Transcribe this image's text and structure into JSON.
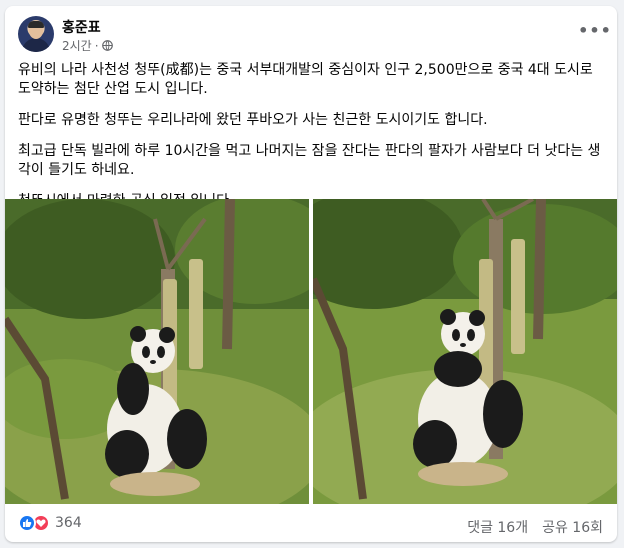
{
  "post": {
    "author": "홍준표",
    "time": "2시간",
    "separator": "·",
    "paragraphs": [
      "유비의 나라 사천성 청뚜(成都)는 중국 서부대개발의 중심이자 인구 2,500만으로 중국 4대 도시로 도약하는 첨단 산업 도시 입니다.",
      "판다로 유명한 청뚜는 우리나라에 왔던 푸바오가 사는 친근한 도시이기도 합니다.",
      "최고급 단독 빌라에 하루 10시간을 먹고 나머지는 잠을 잔다는 판다의 팔자가 사람보다 더 낫다는 생각이 들기도 하네요.",
      "청뚜시에서 마련한 공식 일정 입니다."
    ],
    "more_icon": "•••"
  },
  "footer": {
    "reaction_count": "364",
    "comments": "댓글 16개",
    "shares": "공유 16회"
  },
  "colors": {
    "like": "#1877f2",
    "love": "#f33e58",
    "secondary_text": "#65676b"
  }
}
